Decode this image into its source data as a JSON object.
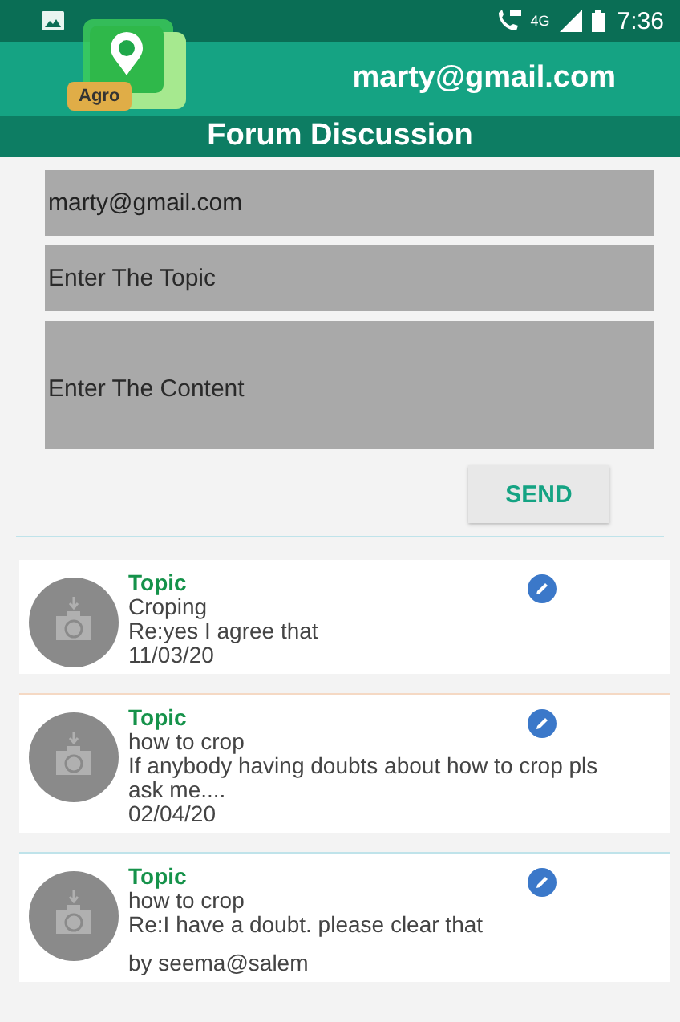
{
  "status_bar": {
    "network": "4G",
    "time": "7:36"
  },
  "header": {
    "logo_text": "Agro",
    "user": "marty@gmail.com"
  },
  "title": "Forum Discussion",
  "form": {
    "fields": [
      {
        "kind": "input",
        "value": "marty@gmail.com"
      },
      {
        "kind": "input",
        "placeholder": "Enter The Topic"
      },
      {
        "kind": "textarea",
        "placeholder": "Enter The Content"
      }
    ],
    "send": "SEND"
  },
  "posts": [
    {
      "label": "Topic",
      "title": "Croping",
      "body": "Re:yes I agree that",
      "footer": "11/03/20",
      "kind": "date"
    },
    {
      "label": "Topic",
      "title": "how to crop",
      "body": "If anybody having doubts about how to crop pls ask me....",
      "footer": "02/04/20",
      "kind": "date"
    },
    {
      "label": "Topic",
      "title": "how to crop",
      "body": "Re:I have a doubt. please clear that",
      "footer": "by seema@salem",
      "kind": "author"
    }
  ]
}
